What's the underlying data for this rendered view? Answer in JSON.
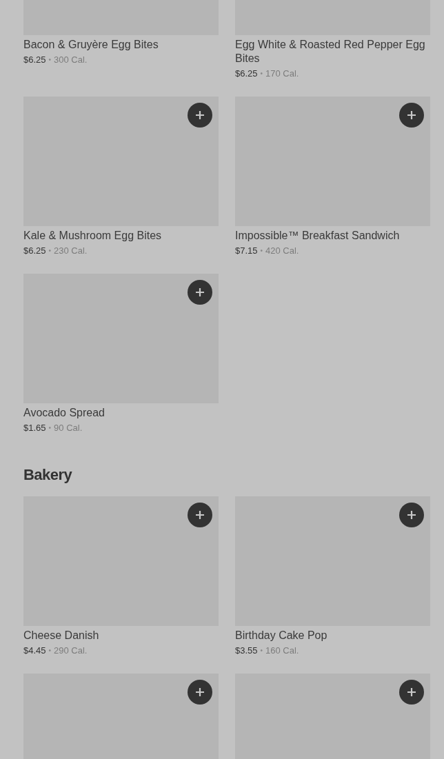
{
  "separator": "•",
  "sections": [
    {
      "items": [
        {
          "name": "Bacon & Gruyère Egg Bites",
          "price": "$6.25",
          "calories": "300 Cal.",
          "add_button": false
        },
        {
          "name": "Egg White & Roasted Red Pepper Egg Bites",
          "price": "$6.25",
          "calories": "170 Cal.",
          "add_button": false
        },
        {
          "name": "Kale & Mushroom Egg Bites",
          "price": "$6.25",
          "calories": "230 Cal.",
          "add_button": true
        },
        {
          "name": "Impossible™ Breakfast Sandwich",
          "price": "$7.15",
          "calories": "420 Cal.",
          "add_button": true
        },
        {
          "name": "Avocado Spread",
          "price": "$1.65",
          "calories": "90 Cal.",
          "add_button": true
        }
      ]
    },
    {
      "heading": "Bakery",
      "items": [
        {
          "name": "Cheese Danish",
          "price": "$4.45",
          "calories": "290 Cal.",
          "add_button": true
        },
        {
          "name": "Birthday Cake Pop",
          "price": "$3.55",
          "calories": "160 Cal.",
          "add_button": true
        },
        {
          "add_button": true
        },
        {
          "add_button": true
        }
      ]
    }
  ]
}
